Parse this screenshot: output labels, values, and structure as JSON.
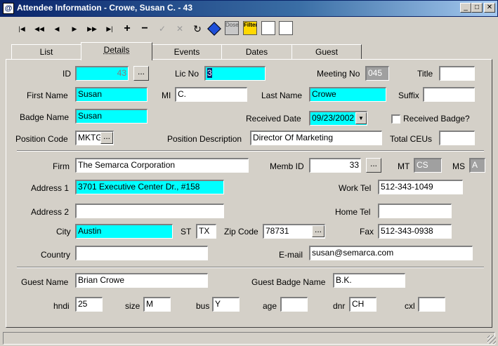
{
  "window": {
    "title": "Attendee Information - Crowe, Susan C. - 43",
    "controls": {
      "minimize": "_",
      "maximize": "□",
      "close": "✕"
    }
  },
  "toolbar": {
    "first": "|◀",
    "prev_page": "◀◀",
    "prev": "◀",
    "next": "▶",
    "next_page": "▶▶",
    "last": "▶|",
    "add": "+",
    "delete": "−",
    "save": "✓",
    "cancel": "✕",
    "refresh": "↻",
    "dose_label": "Dose",
    "filter_label": "Filter"
  },
  "tabs": [
    "List",
    "Details",
    "Events",
    "Dates",
    "Guest"
  ],
  "form": {
    "id_label": "ID",
    "id": "43",
    "id_button": "...",
    "lic_label": "Lic No",
    "lic": "3",
    "meeting_label": "Meeting No",
    "meeting": "045",
    "title_label": "Title",
    "title_value": "",
    "first_label": "First Name",
    "first": "Susan",
    "mi_label": "MI",
    "mi": "C.",
    "last_label": "Last Name",
    "last": "Crowe",
    "suffix_label": "Suffix",
    "suffix": "",
    "badge_label": "Badge Name",
    "badge": "Susan",
    "received_date_label": "Received Date",
    "received_date": "09/23/2002",
    "received_badge_label": "Received Badge?",
    "position_code_label": "Position Code",
    "position_code": "MKTG",
    "position_button": "...",
    "position_desc_label": "Position Description",
    "position_desc": "Director Of Marketing",
    "ceus_label": "Total CEUs",
    "ceus": "",
    "firm_label": "Firm",
    "firm": "The Semarca Corporation",
    "memb_label": "Memb ID",
    "memb": "33",
    "memb_button": "...",
    "mt_label": "MT",
    "mt": "CS",
    "ms_label": "MS",
    "ms": "A",
    "address1_label": "Address 1",
    "address1": "3701 Executive Center Dr., #158",
    "worktel_label": "Work Tel",
    "worktel": "512-343-1049",
    "address2_label": "Address 2",
    "address2": "",
    "hometel_label": "Home Tel",
    "hometel": "",
    "city_label": "City",
    "city": "Austin",
    "st_label": "ST",
    "st": "TX",
    "zip_label": "Zip Code",
    "zip": "78731",
    "zip_button": "...",
    "fax_label": "Fax",
    "fax": "512-343-0938",
    "country_label": "Country",
    "country": "",
    "email_label": "E-mail",
    "email": "susan@semarca.com",
    "guest_name_label": "Guest Name",
    "guest_name": "Brian Crowe",
    "guest_badge_label": "Guest Badge Name",
    "guest_badge": "B.K.",
    "hndi_label": "hndi",
    "hndi": "25",
    "size_label": "size",
    "size": "M",
    "bus_label": "bus",
    "bus": "Y",
    "age_label": "age",
    "age": "",
    "dnr_label": "dnr",
    "dnr": "CH",
    "cxl_label": "cxl",
    "cxl": ""
  }
}
